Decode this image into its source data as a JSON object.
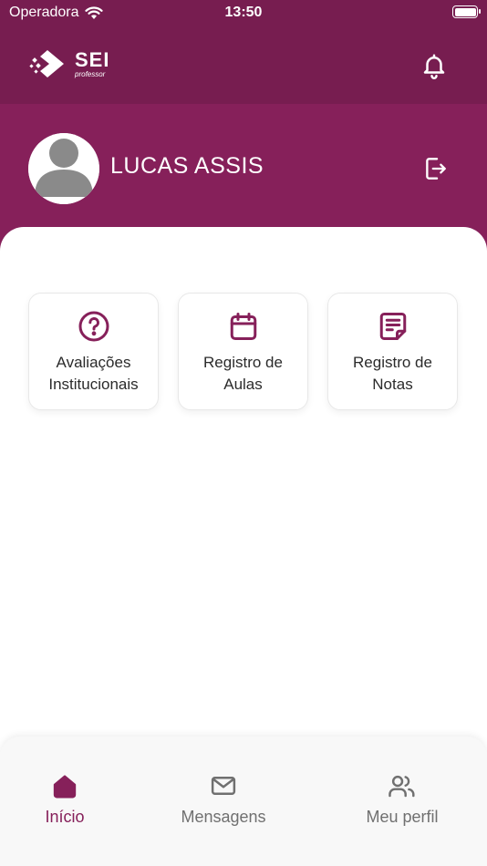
{
  "status_bar": {
    "carrier": "Operadora",
    "time": "13:50"
  },
  "header": {
    "logo": {
      "brand": "SEI",
      "subtitle": "professor",
      "icon": "sei-logo-icon"
    },
    "notifications_icon": "bell-icon"
  },
  "profile": {
    "name": "LUCAS ASSIS",
    "avatar_icon": "user-avatar-icon",
    "logout_icon": "logout-icon"
  },
  "shortcuts": [
    {
      "label_line1": "Avaliações",
      "label_line2": "Institucionais",
      "icon": "question-circle-icon"
    },
    {
      "label_line1": "Registro de",
      "label_line2": "Aulas",
      "icon": "calendar-icon"
    },
    {
      "label_line1": "Registro de",
      "label_line2": "Notas",
      "icon": "notes-icon"
    }
  ],
  "tabbar": {
    "tabs": [
      {
        "label": "Início",
        "icon": "home-icon",
        "active": true
      },
      {
        "label": "Mensagens",
        "icon": "mail-icon",
        "active": false
      },
      {
        "label": "Meu perfil",
        "icon": "users-icon",
        "active": false
      }
    ]
  },
  "colors": {
    "header_dark": "#771d50",
    "header": "#86205a",
    "accent": "#86205a",
    "tab_inactive": "#707070",
    "card_text": "#2b2b2b"
  }
}
